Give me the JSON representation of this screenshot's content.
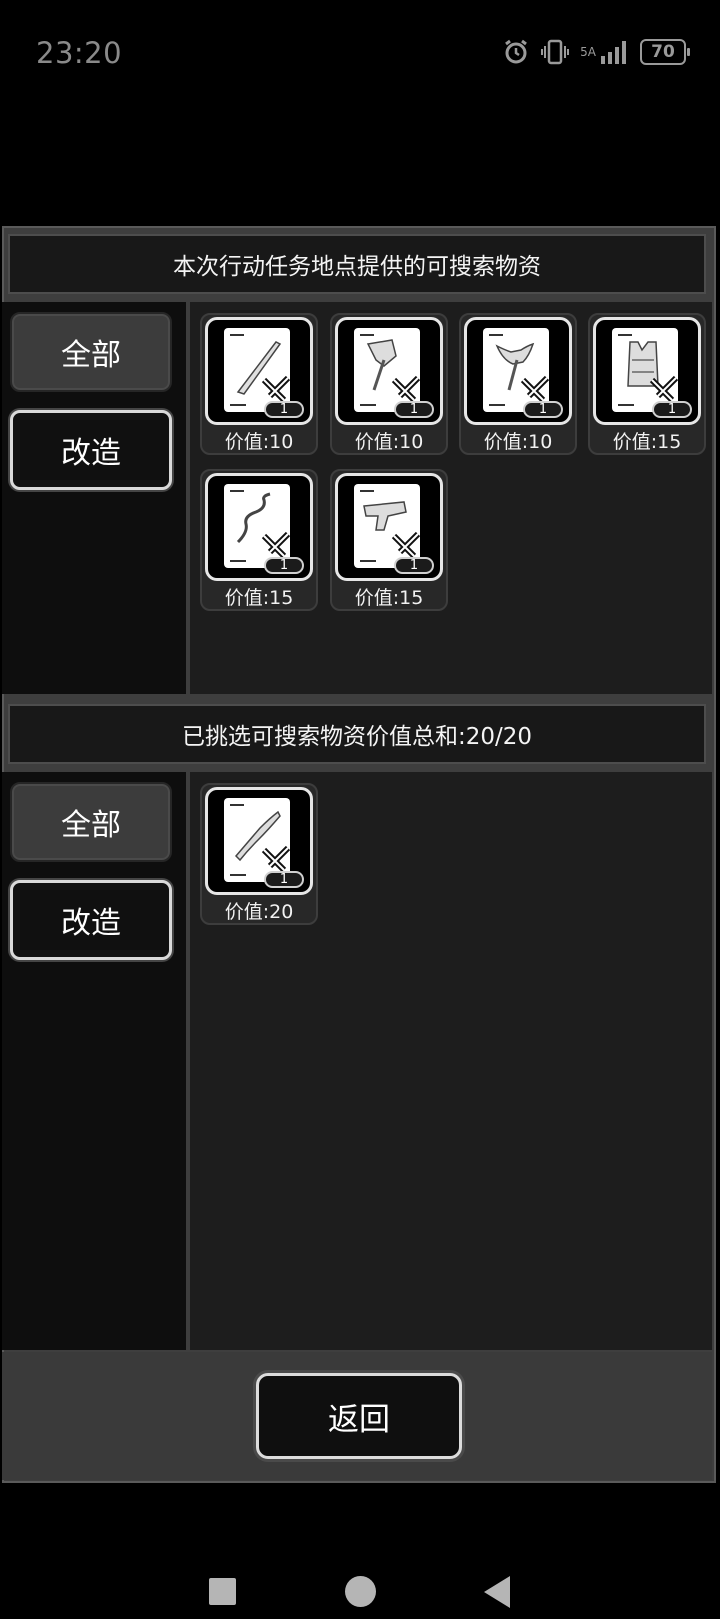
{
  "status_bar": {
    "time": "23:20",
    "network_label": "5A",
    "battery": "70",
    "icons": [
      "alarm-icon",
      "vibrate-icon",
      "signal-icon",
      "battery-icon"
    ]
  },
  "available_section": {
    "title": "本次行动任务地点提供的可搜索物资",
    "tabs": [
      {
        "label": "全部",
        "active": false
      },
      {
        "label": "改造",
        "active": true
      }
    ],
    "items": [
      {
        "icon": "blade-blueprint-icon",
        "quantity": "1",
        "value_label": "价值:10"
      },
      {
        "icon": "axe-blueprint-icon",
        "quantity": "1",
        "value_label": "价值:10"
      },
      {
        "icon": "double-axe-blueprint-icon",
        "quantity": "1",
        "value_label": "价值:10"
      },
      {
        "icon": "vest-blueprint-icon",
        "quantity": "1",
        "value_label": "价值:15"
      },
      {
        "icon": "whip-blueprint-icon",
        "quantity": "1",
        "value_label": "价值:15"
      },
      {
        "icon": "gun-blueprint-icon",
        "quantity": "1",
        "value_label": "价值:15"
      }
    ]
  },
  "selected_section": {
    "title": "已挑选可搜索物资价值总和:20/20",
    "tabs": [
      {
        "label": "全部",
        "active": false
      },
      {
        "label": "改造",
        "active": true
      }
    ],
    "items": [
      {
        "icon": "sword-blueprint-icon",
        "quantity": "1",
        "value_label": "价值:20"
      }
    ]
  },
  "footer": {
    "return_label": "返回"
  },
  "nav_bar": {
    "icons": [
      "recents-square-icon",
      "home-circle-icon",
      "back-triangle-icon"
    ]
  }
}
